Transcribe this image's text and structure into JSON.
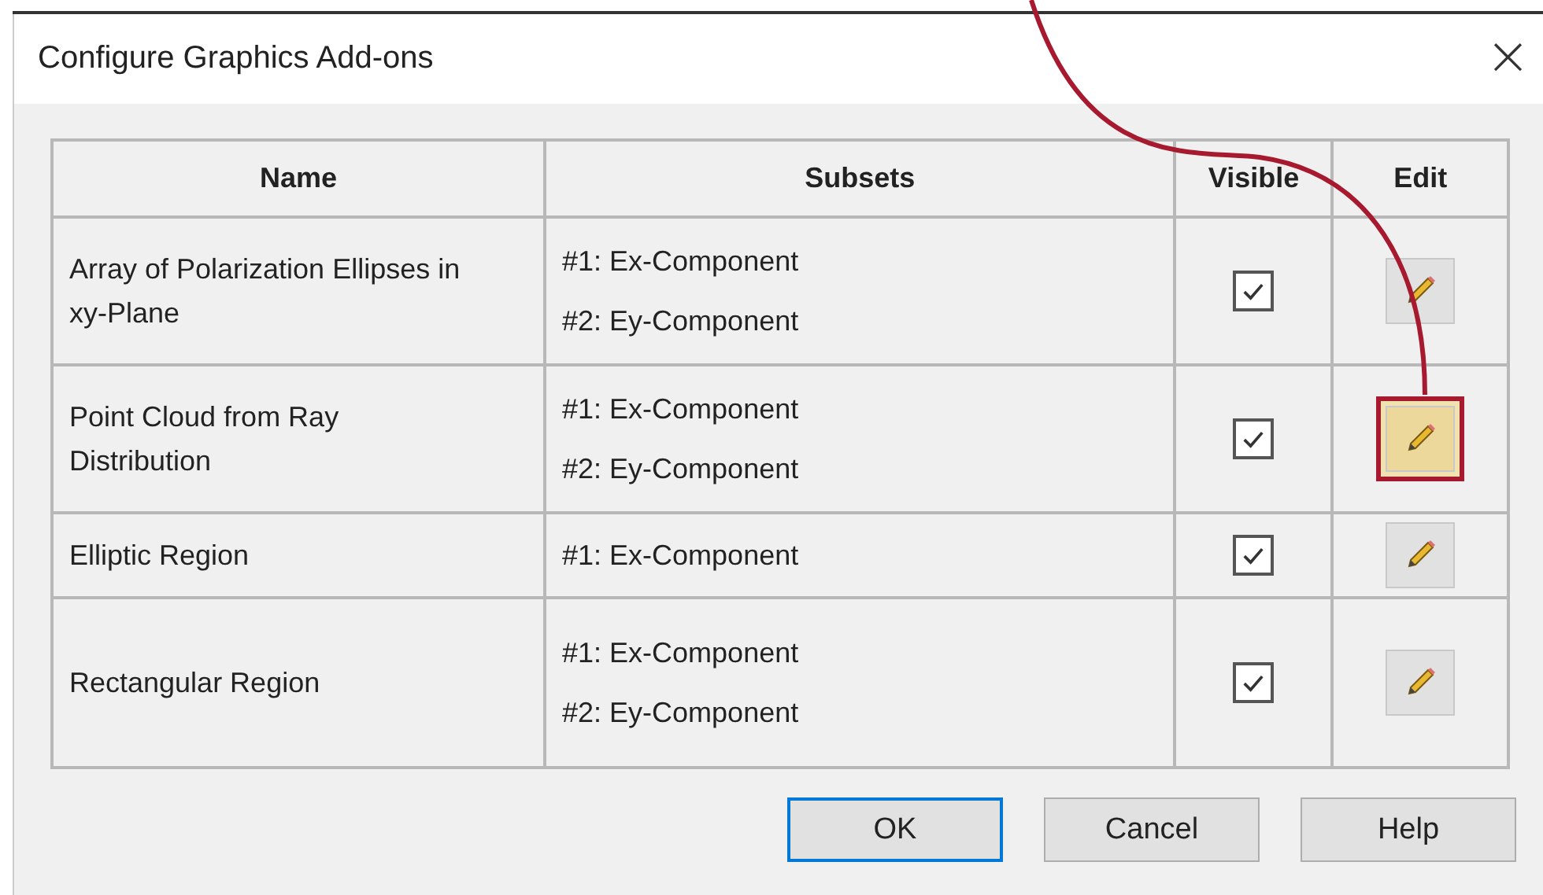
{
  "window": {
    "title": "Configure Graphics Add-ons",
    "close": "×"
  },
  "table": {
    "columns": [
      "Name",
      "Subsets",
      "Visible",
      "Edit"
    ],
    "rows": [
      {
        "name": "Array of Polarization Ellipses in xy-Plane",
        "subsets": [
          "#1: Ex-Component",
          "#2: Ey-Component"
        ],
        "visible": true,
        "highlighted": false
      },
      {
        "name": "Point Cloud from Ray Distribution",
        "subsets": [
          "#1: Ex-Component",
          "#2: Ey-Component"
        ],
        "visible": true,
        "highlighted": true
      },
      {
        "name": "Elliptic Region",
        "subsets": [
          "#1: Ex-Component"
        ],
        "visible": true,
        "highlighted": false
      },
      {
        "name": "Rectangular Region",
        "subsets": [
          "#1: Ex-Component",
          "#2: Ey-Component"
        ],
        "visible": true,
        "highlighted": false
      }
    ]
  },
  "buttons": [
    {
      "label": "OK",
      "selected": true
    },
    {
      "label": "Cancel",
      "selected": false
    },
    {
      "label": "Help",
      "selected": false
    }
  ]
}
